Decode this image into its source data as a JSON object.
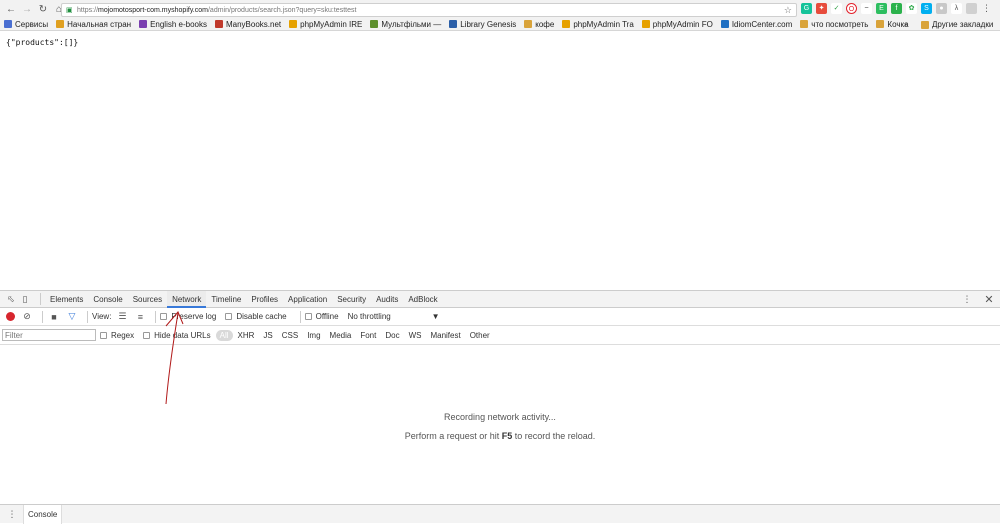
{
  "browser": {
    "url_scheme": "https://",
    "url_host": "mojomotosport-com.myshopify.com",
    "url_path": "/admin/products/search.json?query=sku:testtest"
  },
  "bookmarks": [
    {
      "label": "Сервисы",
      "icon": "apps-grid-icon",
      "color": "#4a6fd1"
    },
    {
      "label": "Начальная стран",
      "icon": "home-favicon",
      "color": "#e0a020"
    },
    {
      "label": "English e-books",
      "icon": "book-favicon",
      "color": "#7a3fb0"
    },
    {
      "label": "ManyBooks.net",
      "icon": "manybooks-favicon",
      "color": "#c0392b"
    },
    {
      "label": "phpMyAdmin IRE",
      "icon": "phpmyadmin-favicon",
      "color": "#e6a100"
    },
    {
      "label": "Мультфільми —",
      "icon": "hyperlink-favicon",
      "color": "#5d8f2d"
    },
    {
      "label": "Library Genesis",
      "icon": "pin-favicon",
      "color": "#2b5fa8"
    },
    {
      "label": "кофе",
      "icon": "folder-icon",
      "color": "#d9a33a"
    },
    {
      "label": "phpMyAdmin Tra",
      "icon": "phpmyadmin-favicon",
      "color": "#e6a100"
    },
    {
      "label": "phpMyAdmin FO",
      "icon": "phpmyadmin-favicon",
      "color": "#e6a100"
    },
    {
      "label": "IdiomCenter.com",
      "icon": "globe-favicon",
      "color": "#1f6fc2"
    },
    {
      "label": "что посмотреть",
      "icon": "folder-icon",
      "color": "#d9a33a"
    },
    {
      "label": "Кочка",
      "icon": "folder-icon",
      "color": "#d9a33a"
    }
  ],
  "bookmarks_more": "»",
  "bookmarks_other": "Другие закладки",
  "page_body": "{\"products\":[]}",
  "devtools": {
    "tabs": [
      "Elements",
      "Console",
      "Sources",
      "Network",
      "Timeline",
      "Profiles",
      "Application",
      "Security",
      "Audits",
      "AdBlock"
    ],
    "active_tab": "Network",
    "toolbar": {
      "view_label": "View:",
      "preserve_log": "Preserve log",
      "disable_cache": "Disable cache",
      "offline": "Offline",
      "throttling": "No throttling"
    },
    "filter": {
      "placeholder": "Filter",
      "regex": "Regex",
      "hide_data_urls": "Hide data URLs",
      "types": [
        "All",
        "XHR",
        "JS",
        "CSS",
        "Img",
        "Media",
        "Font",
        "Doc",
        "WS",
        "Manifest",
        "Other"
      ],
      "active_type": "All"
    },
    "empty_state": {
      "line1": "Recording network activity...",
      "line2_before": "Perform a request or hit ",
      "line2_key": "F5",
      "line2_after": " to record the reload."
    },
    "drawer_tab": "Console"
  },
  "colors": {
    "record": "#d7262e",
    "active_tab_underline": "#3879d9",
    "annotation_arrow": "#b11a1a"
  }
}
